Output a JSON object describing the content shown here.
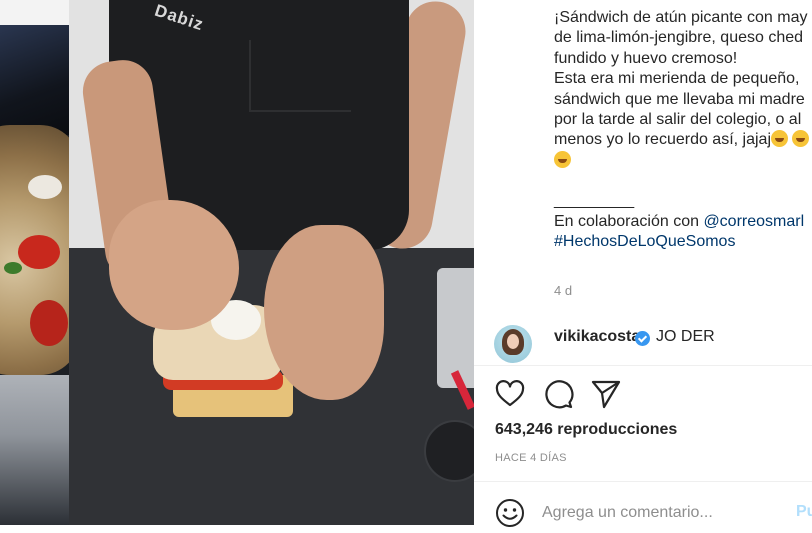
{
  "video": {
    "apron_brand": "Dabiz"
  },
  "caption": {
    "lines": [
      "¡Sándwich de atún picante con may",
      "de lima-limón-jengibre, queso ched",
      "fundido y huevo cremoso!",
      "Esta era mi merienda de pequeño,",
      "sándwich que me llevaba mi madre",
      "por la tarde al salir del colegio, o al",
      "menos yo lo recuerdo así, jajaj"
    ],
    "separator": "_________",
    "collab_prefix": "En colaboración con ",
    "collab_mention": "@correosmarl",
    "hashtag": "#HechosDeLoQueSomos"
  },
  "timestamp": "4 d",
  "comment": {
    "username": "vikikacosta",
    "text": "JO DER"
  },
  "actions": {
    "like_icon": "heart-icon",
    "comment_icon": "comment-icon",
    "share_icon": "paper-plane-icon"
  },
  "stats": {
    "views": "643,246 reproducciones",
    "time_ago": "HACE 4 DÍAS"
  },
  "composer": {
    "placeholder": "Agrega un comentario...",
    "post_label": "Pu"
  },
  "colors": {
    "link": "#00376b",
    "muted": "#8e8e8e",
    "verified": "#3897f0",
    "post_disabled": "#b2dffc"
  }
}
